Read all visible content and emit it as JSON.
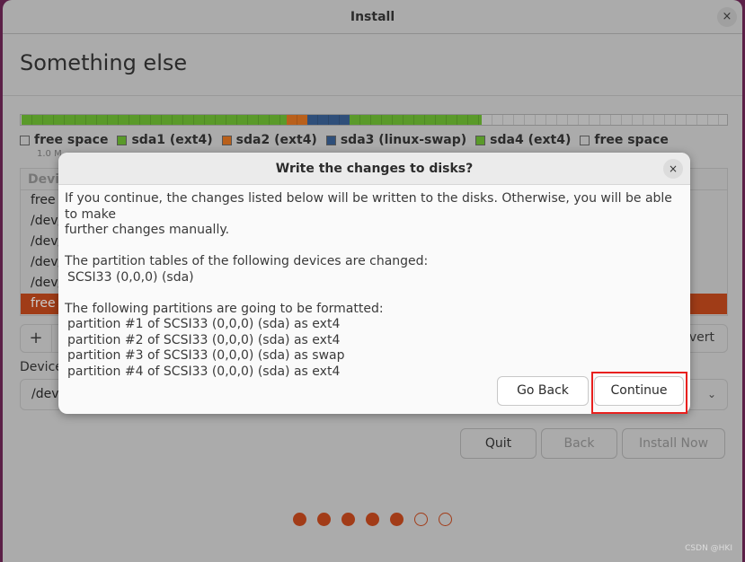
{
  "window": {
    "title": "Install",
    "close": "×"
  },
  "page": {
    "heading": "Something else"
  },
  "partition_bar": [
    {
      "label": "free space",
      "color": "#ababab",
      "fraction": 0.001
    },
    {
      "label": "sda1 (ext4)",
      "color": "#5a9a2a",
      "fraction": 0.376
    },
    {
      "label": "sda2 (ext4)",
      "color": "#b9601b",
      "fraction": 0.029
    },
    {
      "label": "sda3 (linux-swap)",
      "color": "#2f4f7a",
      "fraction": 0.06
    },
    {
      "label": "sda4 (ext4)",
      "color": "#5a9a2a",
      "fraction": 0.187
    },
    {
      "label": "free space",
      "color": "#b0b0b0",
      "fraction": 0.347
    }
  ],
  "first_size": "1.0 M",
  "device_list": {
    "header": "Devic",
    "rows": [
      "free",
      "/dev/",
      "/dev/",
      "/dev/",
      "/dev/",
      "free"
    ],
    "selected_index": 5
  },
  "toolbar": {
    "add": "+",
    "revert": "vert"
  },
  "boot_device": {
    "label": "Device",
    "value": "/dev/",
    "chevron": "⌄"
  },
  "buttons": {
    "quit": "Quit",
    "back": "Back",
    "install": "Install Now"
  },
  "progress": {
    "steps_total": 7,
    "steps_done": 5
  },
  "watermark": "CSDN @HKI",
  "dialog": {
    "title": "Write the changes to disks?",
    "close": "×",
    "intro1": "If you continue, the changes listed below will be written to the disks. Otherwise, you will be able to make",
    "intro2": "further changes manually.",
    "tables_heading": "The partition tables of the following devices are changed:",
    "tables": [
      "SCSI33 (0,0,0) (sda)"
    ],
    "format_heading": "The following partitions are going to be formatted:",
    "formats": [
      "partition #1 of SCSI33 (0,0,0) (sda) as ext4",
      "partition #2 of SCSI33 (0,0,0) (sda) as ext4",
      "partition #3 of SCSI33 (0,0,0) (sda) as swap",
      "partition #4 of SCSI33 (0,0,0) (sda) as ext4"
    ],
    "go_back": "Go Back",
    "continue": "Continue",
    "highlight_color": "#e8201e"
  }
}
